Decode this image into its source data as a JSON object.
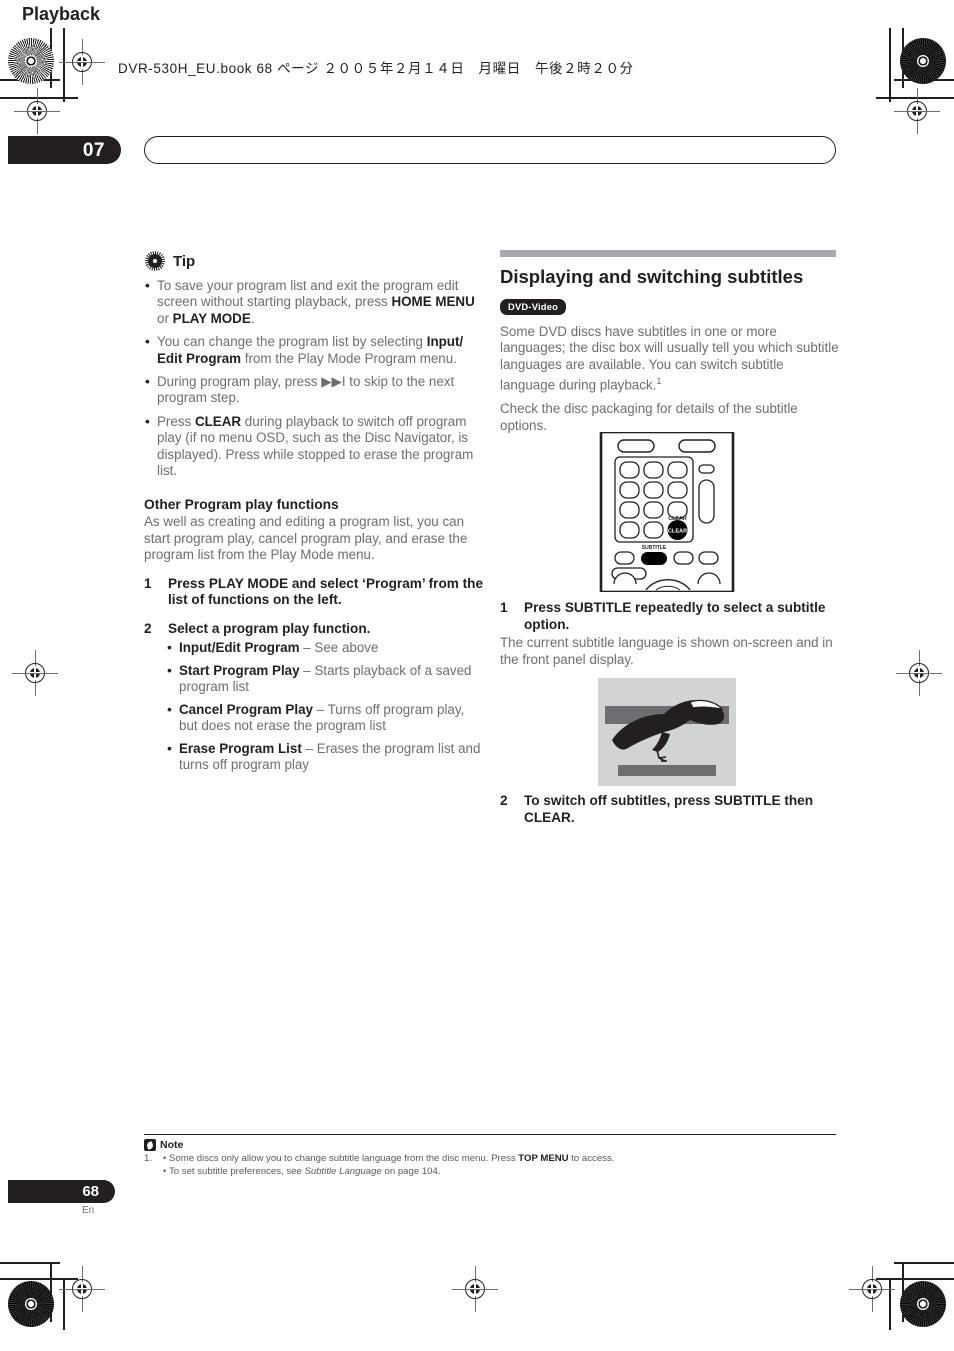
{
  "header": {
    "book_line": "DVR-530H_EU.book  68 ページ  ２００５年２月１４日　月曜日　午後２時２０分"
  },
  "chapter": {
    "number": "07",
    "title": "Playback"
  },
  "left_column": {
    "tip": {
      "icon": "gear-icon",
      "label": "Tip",
      "bullets": [
        "To save your program list and exit the program edit screen without starting playback, press <b>HOME MENU</b> or <b>PLAY MODE</b>.",
        "You can change the program list by selecting <b>Input/ Edit Program</b> from the Play Mode Program menu.",
        "During program play, press ▶▶I to skip to the next program step.",
        "Press <b>CLEAR</b> during playback to switch off program play (if no menu OSD, such as the Disc Navigator, is displayed). Press while stopped to erase the program list."
      ]
    },
    "other_functions": {
      "heading": "Other Program play functions",
      "intro": "As well as creating and editing a program list, you can start program play, cancel program play, and erase the program list from the Play Mode menu.",
      "step1_num": "1",
      "step1_text": "Press PLAY MODE and select ‘Program’ from the list of functions on the left.",
      "step2_num": "2",
      "step2_text": "Select a program play function.",
      "options": [
        "<b>Input/Edit Program</b> – See above",
        "<b>Start Program Play</b> – Starts playback of a saved program list",
        "<b>Cancel Program Play</b> – Turns off program play, but does not erase the program list",
        "<b>Erase Program List</b> – Erases the program list and turns off program play"
      ]
    }
  },
  "right_column": {
    "section_title": "Displaying and switching subtitles",
    "badge": "DVD-Video",
    "intro_para": "Some DVD discs have subtitles in one or more languages; the disc box will usually tell you which subtitle languages are available. You can switch subtitle language during playback.",
    "intro_footnote_marker": "1",
    "second_para": "Check the disc packaging for details of the subtitle options.",
    "remote": {
      "clear_label_top": "CLEAR",
      "clear_button_text": "CLEAR",
      "subtitle_label": "SUBTITLE"
    },
    "step1_num": "1",
    "step1_text": "Press SUBTITLE repeatedly to select a subtitle option.",
    "step1_body": "The current subtitle language is shown on-screen and in the front panel display.",
    "step2_num": "2",
    "step2_text": "To switch off subtitles, press SUBTITLE then CLEAR."
  },
  "note": {
    "icon": "note-icon",
    "label": "Note",
    "items": [
      {
        "marker": "1.",
        "bullet": "•",
        "text": "Some discs only allow you to change subtitle language from the disc menu. Press <b>TOP MENU</b> to access."
      },
      {
        "marker": "",
        "bullet": "•",
        "text": "To set subtitle preferences, see <i>Subtitle Language</i> on page 104."
      }
    ]
  },
  "footer": {
    "page_number": "68",
    "language": "En"
  },
  "colors": {
    "ink": "#231f20",
    "body_gray": "#6d6e71",
    "rule_gray": "#a7a9ac",
    "screen_bg": "#d2d3d4",
    "subtitle_bar": "#6d6e71"
  }
}
